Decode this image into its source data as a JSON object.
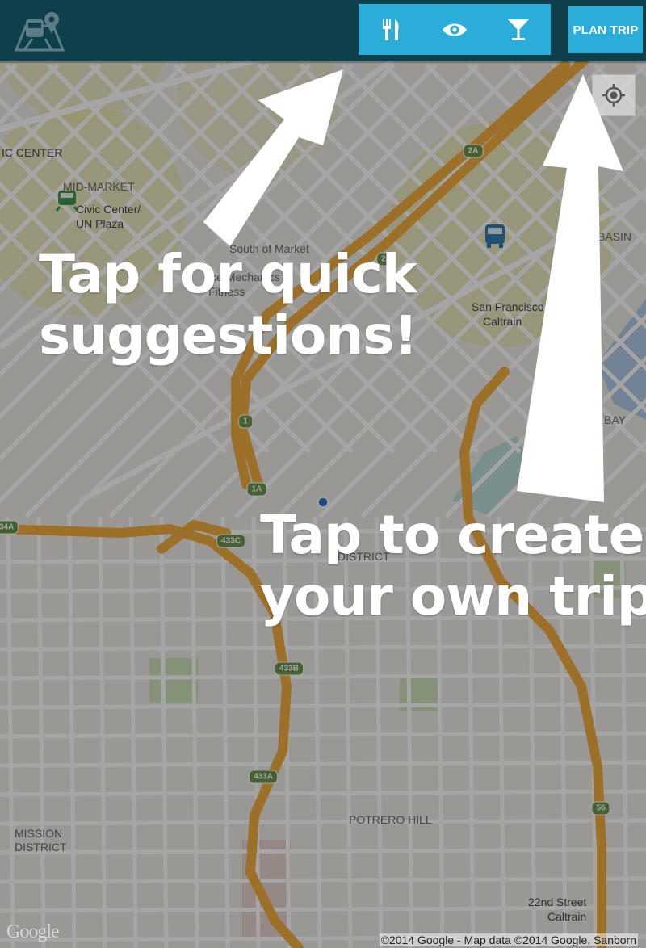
{
  "app": {
    "logo_icon": "map-vehicle-logo-icon"
  },
  "toolbar": {
    "quick_buttons": [
      {
        "name": "restaurant-button",
        "icon": "fork-knife-icon"
      },
      {
        "name": "sightseeing-button",
        "icon": "eye-icon"
      },
      {
        "name": "nightlife-button",
        "icon": "cocktail-glass-icon"
      }
    ],
    "plan_trip_label": "PLAN TRIP",
    "accent_color": "#2aaed9",
    "bar_color": "#0f3f4a"
  },
  "map": {
    "labels": {
      "civic_center": "IC CENTER",
      "mid_market": "MID-MARKET",
      "civic_center_plaza_1": "Civic Center/",
      "civic_center_plaza_2": "UN Plaza",
      "south_of_market": "South of Market",
      "mechanics_1": "ice Mechanics",
      "mechanics_2": "Fitness",
      "sf_caltrain_1": "San Francisco",
      "sf_caltrain_2": "Caltrain",
      "basin": "BASIN",
      "bay": "BAY",
      "district": "DISTRICT",
      "potrero_hill": "POTRERO HILL",
      "mission_1": "MISSION",
      "mission_2": "DISTRICT",
      "caltrain22_1": "22nd Street",
      "caltrain22_2": "Caltrain"
    },
    "shields": [
      "2A",
      "2",
      "1",
      "1A",
      "433C",
      "433B",
      "433A",
      "56",
      "34A"
    ],
    "attribution": "©2014 Google - Map data ©2014 Google, Sanborn",
    "google_logo": "Google",
    "locate_icon": "my-location-icon"
  },
  "tutorial": {
    "quick_line1": "Tap for quick",
    "quick_line2": "suggestions!",
    "plan_line1": "Tap to  create",
    "plan_line2": "your own trip!"
  }
}
